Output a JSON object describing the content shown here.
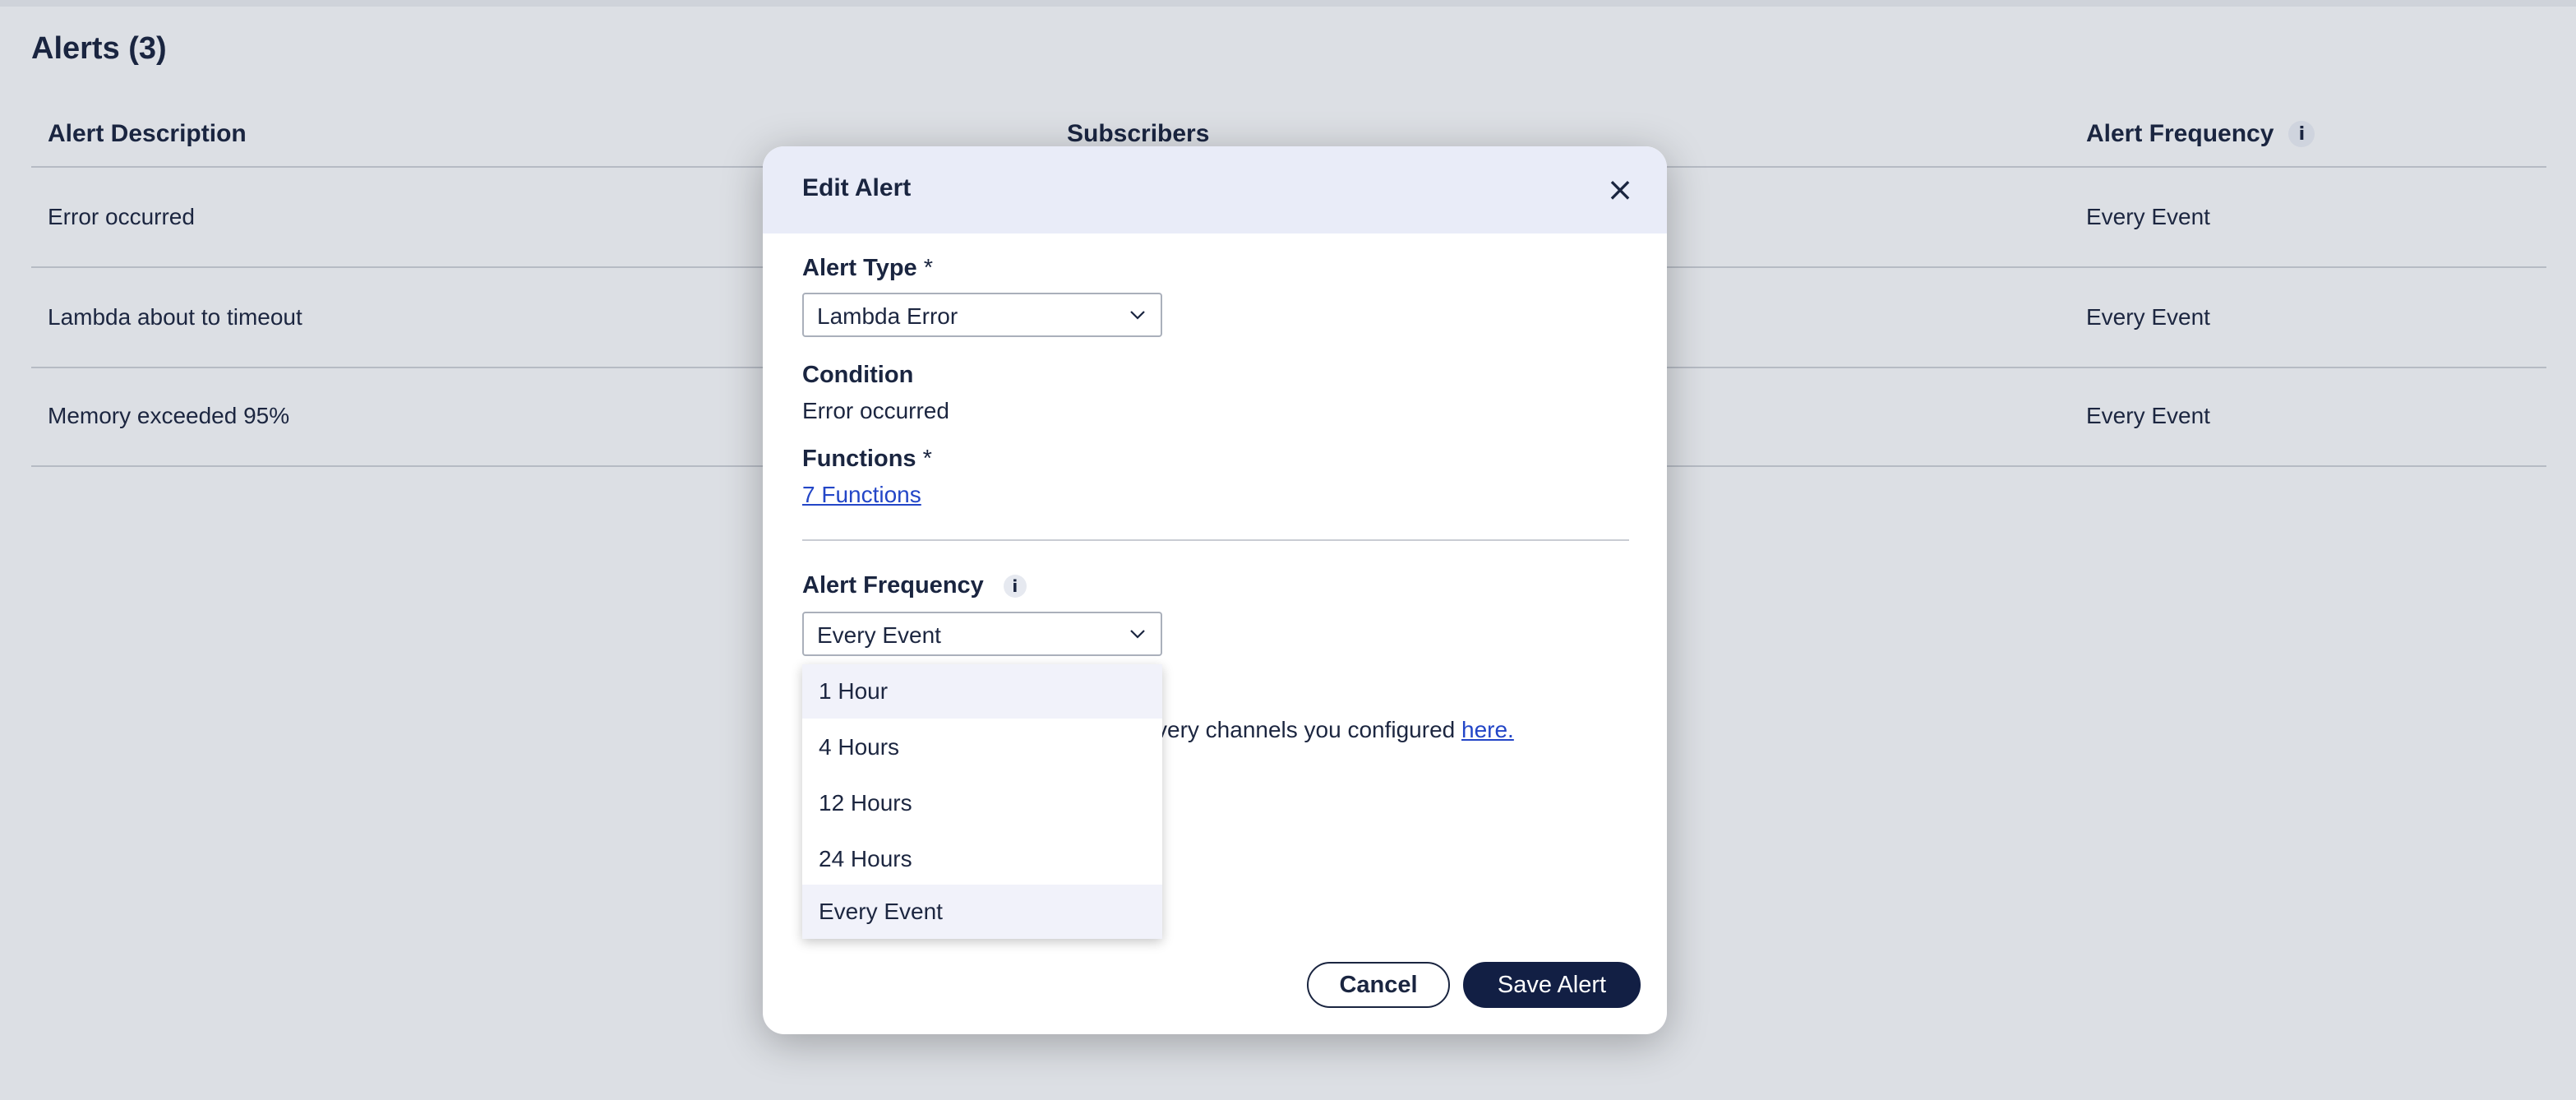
{
  "page": {
    "title": "Alerts (3)"
  },
  "table": {
    "headers": {
      "description": "Alert Description",
      "subscribers": "Subscribers",
      "frequency": "Alert Frequency",
      "frequency_info": "i"
    },
    "rows": [
      {
        "description": "Error occurred",
        "frequency": "Every Event"
      },
      {
        "description": "Lambda about to timeout",
        "frequency": "Every Event"
      },
      {
        "description": "Memory exceeded 95%",
        "frequency": "Every Event"
      }
    ]
  },
  "modal": {
    "title": "Edit Alert",
    "close_icon": "×",
    "alert_type": {
      "label": "Alert Type",
      "required_mark": "*",
      "value": "Lambda Error"
    },
    "condition": {
      "label": "Condition",
      "value": "Error occurred"
    },
    "functions": {
      "label": "Functions",
      "required_mark": "*",
      "link": "7 Functions"
    },
    "frequency": {
      "label": "Alert Frequency",
      "info": "i",
      "value": "Every Event",
      "options": [
        "1 Hour",
        "4 Hours",
        "12 Hours",
        "24 Hours",
        "Every Event"
      ]
    },
    "note": {
      "text": "very channels you configured ",
      "link": "here."
    },
    "buttons": {
      "cancel": "Cancel",
      "save": "Save Alert"
    }
  },
  "colors": {
    "background": "#dcdfe4",
    "modal_header": "#e9ecf8",
    "primary_button": "#121f44",
    "link": "#2346c7",
    "option_highlight": "#f1f2fa"
  },
  "icons": {
    "close": "close-icon",
    "chevron": "chevron-down-icon",
    "info": "info-icon"
  }
}
